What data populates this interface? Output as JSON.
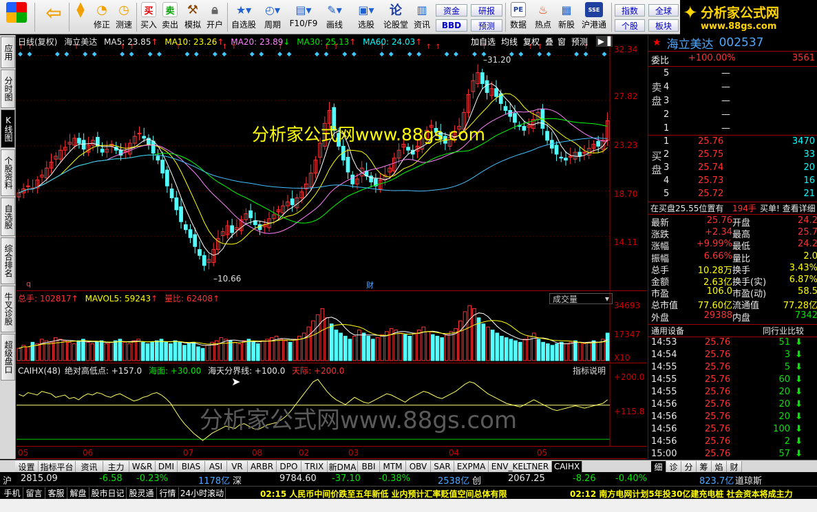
{
  "toolbar": {
    "buttons": [
      {
        "label": "",
        "icon": "app-logo"
      },
      {
        "label": "",
        "icon": "back-arrow"
      },
      {
        "label": "",
        "icon": "up-down-arrows"
      },
      {
        "label": "修正",
        "icon": "revise"
      },
      {
        "label": "测速",
        "icon": "speed-test"
      },
      {
        "label": "买入",
        "icon": "buy",
        "glyph": "买"
      },
      {
        "label": "卖出",
        "icon": "sell",
        "glyph": "卖"
      },
      {
        "label": "模拟",
        "icon": "simulate"
      },
      {
        "label": "开户",
        "icon": "open-account"
      },
      {
        "label": "自选股",
        "icon": "watchlist"
      },
      {
        "label": "周期",
        "icon": "period"
      },
      {
        "label": "F10/F9",
        "icon": "f10"
      },
      {
        "label": "画线",
        "icon": "draw-line"
      },
      {
        "label": "选股",
        "icon": "stock-picker"
      },
      {
        "label": "论股堂",
        "icon": "forum",
        "glyph": "论"
      },
      {
        "label": "资讯",
        "icon": "news"
      },
      {
        "label": "数据",
        "icon": "data",
        "glyph": "PE"
      },
      {
        "label": "热点",
        "icon": "hotspot"
      },
      {
        "label": "新股",
        "icon": "new-stock"
      },
      {
        "label": "沪港通",
        "icon": "hk-connect",
        "glyph": "SSE"
      }
    ],
    "small_buttons": [
      "资金",
      "BBD",
      "研报",
      "预测",
      "指数",
      "个股",
      "全球",
      "板块"
    ]
  },
  "logo": {
    "line1": "分析家公式网",
    "line2": "www.88gs.com"
  },
  "left_tabs": [
    "应用",
    "分时图",
    "K线图",
    "个股资料",
    "自选股",
    "综合排名",
    "牛叉诊股",
    "超级盘口"
  ],
  "main_chart": {
    "stock_name": "海立美达",
    "period_label": "日线(复权)",
    "ma5": "MA5: 23.85",
    "ma10": "MA10: 23.26",
    "ma20": "MA20: 23.89",
    "ma30": "MA30: 25.13",
    "ma60": "MA60: 24.03",
    "buttons": [
      "加自选",
      "均线",
      "复权",
      "叠",
      "窗",
      "预测"
    ],
    "y_ticks": [
      "32.34",
      "27.82",
      "23.23",
      "18.70",
      "14.11"
    ],
    "high_label": "31.20",
    "low_label": "10.66",
    "watermark": "分析家公式网www.88gs.com",
    "marker_q": "q",
    "marker_cai": "财"
  },
  "chart_data": {
    "type": "candlestick",
    "y_range": [
      10.0,
      33.0
    ],
    "high": 31.2,
    "low": 10.66,
    "closes": [
      18.5,
      18.9,
      19.2,
      19.0,
      19.8,
      20.3,
      21.0,
      21.6,
      22.2,
      22.8,
      23.1,
      23.6,
      24.0,
      23.5,
      22.9,
      23.3,
      23.8,
      23.2,
      22.6,
      22.9,
      23.4,
      22.8,
      22.3,
      22.7,
      23.5,
      24.2,
      24.5,
      24.0,
      23.4,
      22.5,
      21.8,
      20.5,
      19.2,
      18.0,
      16.8,
      15.6,
      14.8,
      14.0,
      13.1,
      12.2,
      11.2,
      11.8,
      12.8,
      13.9,
      14.6,
      15.2,
      14.5,
      15.0,
      15.8,
      16.4,
      16.0,
      15.3,
      14.8,
      15.3,
      15.9,
      16.3,
      16.8,
      17.2,
      17.6,
      17.3,
      18.0,
      18.6,
      19.4,
      20.5,
      21.8,
      23.5,
      25.5,
      26.8,
      24.8,
      23.2,
      21.8,
      20.6,
      19.4,
      19.9,
      21.0,
      20.2,
      19.6,
      19.2,
      19.8,
      20.3,
      21.0,
      22.0,
      22.8,
      23.4,
      22.8,
      22.4,
      23.2,
      24.0,
      24.8,
      25.3,
      24.6,
      23.9,
      23.5,
      24.1,
      24.6,
      25.2,
      26.6,
      28.4,
      29.8,
      30.6,
      29.5,
      28.6,
      29.0,
      28.2,
      27.5,
      26.8,
      26.2,
      25.6,
      25.2,
      24.8,
      25.3,
      25.9,
      26.6,
      25.0,
      23.8,
      23.0,
      22.4,
      22.0,
      21.8,
      22.2,
      22.6,
      22.2,
      22.6,
      23.0,
      23.4,
      23.2,
      23.8,
      25.76
    ],
    "ma_series": [
      {
        "name": "MA5",
        "color": "#ffffff"
      },
      {
        "name": "MA10",
        "color": "#ffff00"
      },
      {
        "name": "MA20",
        "color": "#ff80ff"
      },
      {
        "name": "MA30",
        "color": "#00ff00"
      },
      {
        "name": "MA60",
        "color": "#40c0ff"
      }
    ]
  },
  "volume_chart": {
    "total_label": "总手: 102817",
    "mavol_label": "MAVOL5: 59243",
    "ratio_label": "量比: 62408",
    "dropdown": "成交量",
    "y_ticks": [
      "34693",
      "17347"
    ],
    "unit": "X10",
    "volumes": [
      8,
      10,
      9,
      12,
      11,
      14,
      13,
      12,
      15,
      14,
      13,
      12,
      11,
      13,
      14,
      12,
      11,
      12,
      13,
      11,
      12,
      13,
      14,
      12,
      11,
      13,
      14,
      12,
      11,
      12,
      13,
      14,
      12,
      11,
      13,
      12,
      10,
      11,
      12,
      9,
      8,
      10,
      12,
      13,
      15,
      14,
      13,
      12,
      11,
      13,
      14,
      12,
      11,
      13,
      14,
      15,
      16,
      14,
      13,
      12,
      14,
      16,
      18,
      22,
      26,
      30,
      34,
      28,
      24,
      20,
      18,
      16,
      14,
      16,
      20,
      18,
      16,
      14,
      15,
      17,
      19,
      21,
      20,
      18,
      17,
      16,
      18,
      20,
      22,
      19,
      17,
      16,
      15,
      17,
      19,
      21,
      26,
      32,
      36,
      34,
      28,
      24,
      22,
      20,
      18,
      16,
      15,
      14,
      13,
      12,
      14,
      16,
      18,
      14,
      12,
      11,
      10,
      11,
      12,
      11,
      12,
      13,
      12,
      11,
      12,
      13,
      12,
      14,
      18
    ]
  },
  "indicator_chart": {
    "name": "CAIHX(48)",
    "label1": "绝对高低点: +157.0",
    "label2": "海面: +30.00",
    "label3": "海天分界线: +100.0",
    "label4": "天际: +200.0",
    "button": "指标说明",
    "y_ticks": [
      "+200.0",
      "+115.8"
    ],
    "watermark": "分析家公式网www.88gs.com",
    "values": [
      175,
      172,
      178,
      176,
      174,
      180,
      178,
      176,
      170,
      172,
      174,
      168,
      170,
      166,
      172,
      176,
      174,
      178,
      176,
      172,
      170,
      174,
      176,
      172,
      168,
      164,
      166,
      170,
      172,
      176,
      178,
      174,
      168,
      160,
      148,
      136,
      126,
      118,
      110,
      104,
      98,
      104,
      110,
      114,
      118,
      122,
      120,
      118,
      124,
      126,
      122,
      118,
      116,
      120,
      124,
      126,
      128,
      132,
      138,
      146,
      156,
      166,
      176,
      186,
      196,
      200,
      190,
      180,
      172,
      166,
      162,
      158,
      164,
      170,
      166,
      162,
      160,
      164,
      168,
      172,
      176,
      174,
      170,
      166,
      162,
      168,
      172,
      176,
      180,
      178,
      174,
      170,
      168,
      172,
      176,
      180,
      186,
      192,
      196,
      194,
      188,
      182,
      176,
      172,
      168,
      164,
      160,
      158,
      156,
      154,
      158,
      162,
      166,
      162,
      158,
      154,
      150,
      148,
      150,
      152,
      154,
      156,
      154,
      152,
      154,
      156,
      158,
      160,
      166
    ]
  },
  "x_axis": [
    "05",
    "06",
    "07",
    "08",
    "02",
    "03",
    "04",
    "05"
  ],
  "bottom_tabs": [
    "设置",
    "指标平台",
    "资讯",
    "主力",
    "W&R",
    "DMI",
    "BIAS",
    "ASI",
    "VR",
    "ARBR",
    "DPO",
    "TRIX",
    "新DMA",
    "BBI",
    "MTM",
    "OBV",
    "SAR",
    "EXPMA",
    "ENV_KELTNER",
    "CAIHX"
  ],
  "right_tabs": [
    "细",
    "诊",
    "分",
    "筹",
    "焰",
    "财"
  ],
  "quote": {
    "name": "海立美达",
    "code": "002537",
    "weibi_label": "委比",
    "weibi_value": "+100.00%",
    "weibi_diff": "3561",
    "sell_label": "卖盘",
    "buy_label": "买盘",
    "sell": [
      {
        "level": "5",
        "price": "—",
        "vol": ""
      },
      {
        "level": "4",
        "price": "—",
        "vol": ""
      },
      {
        "level": "3",
        "price": "—",
        "vol": ""
      },
      {
        "level": "2",
        "price": "—",
        "vol": ""
      },
      {
        "level": "1",
        "price": "—",
        "vol": ""
      }
    ],
    "buy": [
      {
        "level": "1",
        "price": "25.76",
        "vol": "3470"
      },
      {
        "level": "2",
        "price": "25.75",
        "vol": "33"
      },
      {
        "level": "3",
        "price": "25.74",
        "vol": "20"
      },
      {
        "level": "4",
        "price": "25.73",
        "vol": "16"
      },
      {
        "level": "5",
        "price": "25.72",
        "vol": "21"
      }
    ],
    "notice": "在买盘25.55位置有",
    "notice_vol": "194手",
    "notice_btn": "买单! 查看详细",
    "stats": [
      {
        "l1": "最新",
        "v1": "25.76",
        "l2": "开盘",
        "v2": "24.2"
      },
      {
        "l1": "涨跌",
        "v1": "+2.34",
        "l2": "最高",
        "v2": "25.7"
      },
      {
        "l1": "涨幅",
        "v1": "+9.99%",
        "l2": "最低",
        "v2": "24.2"
      },
      {
        "l1": "振幅",
        "v1": "6.66%",
        "l2": "量比",
        "v2": "2.0"
      },
      {
        "l1": "总手",
        "v1": "10.28万",
        "l2": "换手",
        "v2": "3.43%"
      },
      {
        "l1": "金额",
        "v1": "2.63亿",
        "l2": "换手(实)",
        "v2": "6.87%"
      },
      {
        "l1": "市盈",
        "v1": "106.0",
        "l2": "市盈(动)",
        "v2": "58.5"
      },
      {
        "l1": "总市值",
        "v1": "77.60亿",
        "l2": "流通值",
        "v2": "77.28亿"
      },
      {
        "l1": "外盘",
        "v1": "29388",
        "l2": "内盘",
        "v2": "7342"
      }
    ],
    "tick_tab1": "通用设备",
    "tick_tab2": "同行业比较",
    "ticks": [
      {
        "time": "14:53",
        "price": "25.76",
        "vol": "51"
      },
      {
        "time": "14:54",
        "price": "25.76",
        "vol": "3"
      },
      {
        "time": "14:55",
        "price": "25.76",
        "vol": "5"
      },
      {
        "time": "14:55",
        "price": "25.76",
        "vol": "60"
      },
      {
        "time": "14:55",
        "price": "25.76",
        "vol": "20"
      },
      {
        "time": "14:56",
        "price": "25.76",
        "vol": "20"
      },
      {
        "time": "14:56",
        "price": "25.76",
        "vol": "20"
      },
      {
        "time": "14:56",
        "price": "25.76",
        "vol": "100"
      },
      {
        "time": "14:56",
        "price": "25.76",
        "vol": "2"
      },
      {
        "time": "15:00",
        "price": "25.76",
        "vol": "57"
      }
    ]
  },
  "status": {
    "sh_label": "沪",
    "sh_value": "2815.09",
    "sh_change": "-6.58",
    "sh_pct": "-0.23%",
    "sh_amount": "1178亿",
    "sz_label": "深",
    "sz_value": "9784.60",
    "sz_change": "-37.10",
    "sz_pct": "-0.38%",
    "sz_amount": "2538亿",
    "cy_label": "创",
    "cy_value": "2067.25",
    "cy_change": "-8.26",
    "cy_pct": "-0.40%",
    "cy_amount": "823.7亿",
    "dj_label": "道琼斯"
  },
  "bottom_buttons": [
    "手机",
    "留言",
    "客服",
    "解盘",
    "股市日记",
    "股灵通",
    "行情",
    "24小时滚动"
  ],
  "news1": "02:15 人民币中间价跌至五年新低 业内预计汇率贬值空间总体有限",
  "news2": "02:12 南方电网计划5年投30亿建充电桩 社会资本将成主力"
}
